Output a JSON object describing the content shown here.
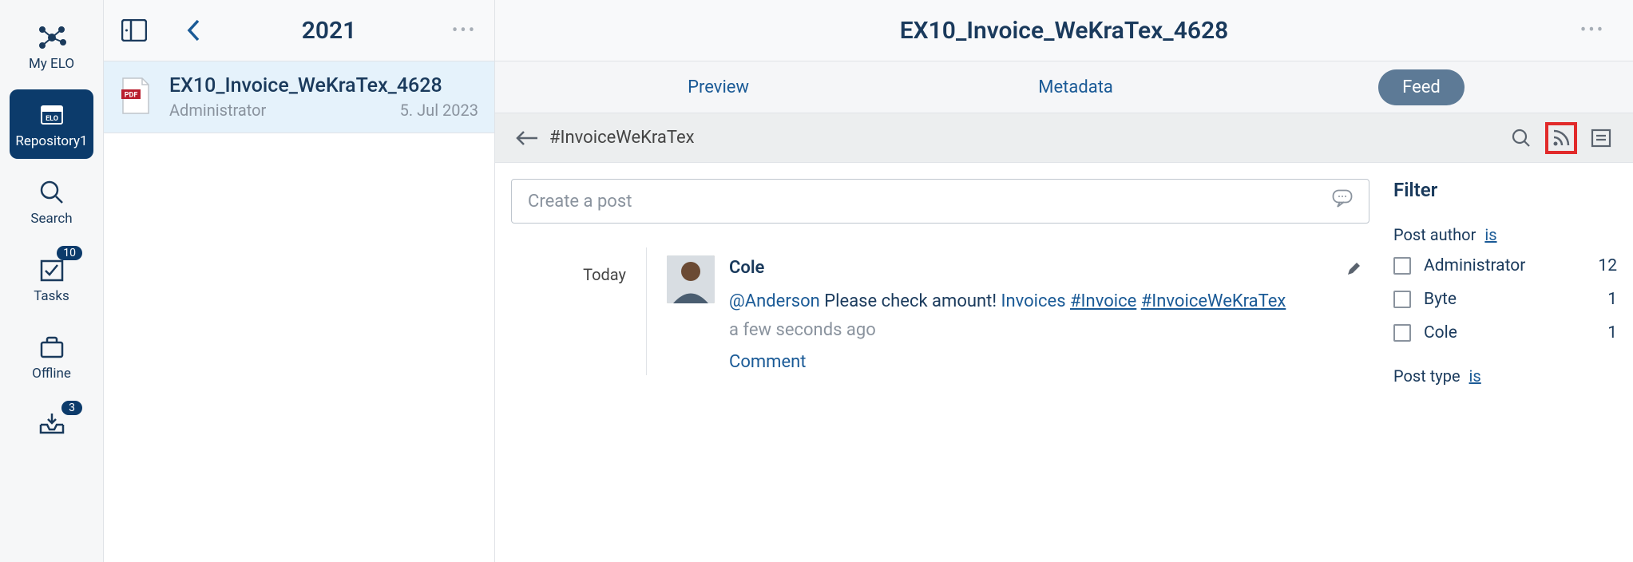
{
  "nav": {
    "items": [
      {
        "label": "My ELO",
        "name": "my-elo",
        "badge": null
      },
      {
        "label": "Repository1",
        "name": "repository",
        "badge": null,
        "active": true
      },
      {
        "label": "Search",
        "name": "search",
        "badge": null
      },
      {
        "label": "Tasks",
        "name": "tasks",
        "badge": "10"
      },
      {
        "label": "Offline",
        "name": "offline",
        "badge": null
      },
      {
        "label": "",
        "name": "inbox",
        "badge": "3"
      }
    ]
  },
  "list": {
    "header_title": "2021",
    "items": [
      {
        "title": "EX10_Invoice_WeKraTex_4628",
        "owner": "Administrator",
        "date": "5. Jul 2023",
        "filetype": "PDF"
      }
    ]
  },
  "detail": {
    "title": "EX10_Invoice_WeKraTex_4628",
    "tabs": [
      {
        "label": "Preview",
        "name": "preview"
      },
      {
        "label": "Metadata",
        "name": "metadata"
      },
      {
        "label": "Feed",
        "name": "feed",
        "active": true
      }
    ],
    "breadcrumb_text": "#InvoiceWeKraTex",
    "create_post_placeholder": "Create a post",
    "post_date_label": "Today",
    "post": {
      "author": "Cole",
      "mention": "@Anderson",
      "body_before_link": " Please check amount! ",
      "link_text": "Invoices",
      "hashtag1": "#Invoice",
      "hashtag2": "#InvoiceWeKraTex",
      "time_ago": "a few seconds ago",
      "comment_label": "Comment"
    }
  },
  "filter": {
    "title": "Filter",
    "group1_label": "Post author",
    "group1_link": "is",
    "options1": [
      {
        "label": "Administrator",
        "count": "12"
      },
      {
        "label": "Byte",
        "count": "1"
      },
      {
        "label": "Cole",
        "count": "1"
      }
    ],
    "group2_label": "Post type",
    "group2_link": "is"
  }
}
